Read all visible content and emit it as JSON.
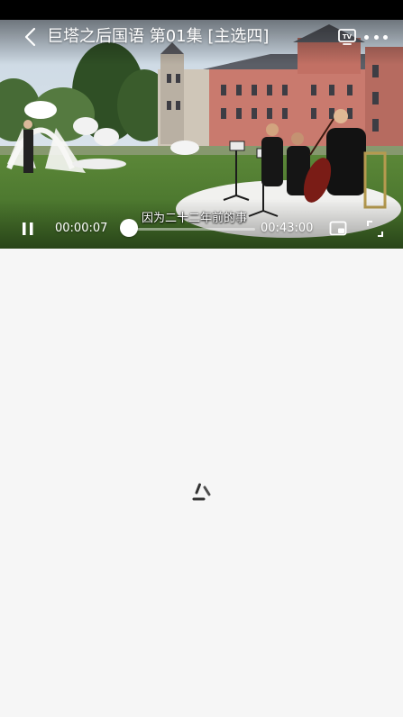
{
  "player": {
    "title": "巨塔之后国语 第01集 [主选四]",
    "subtitle": "因为二十二年前的事",
    "current_time": "00:00:07",
    "total_time": "00:43:00",
    "progress_fraction": 0.0027,
    "tv_badge": "TV"
  },
  "icons": {
    "back": "chevron-left-icon",
    "tv": "tv-cast-icon",
    "more": "more-dots-icon",
    "pause": "pause-icon",
    "pip": "picture-in-picture-icon",
    "fullscreen": "fullscreen-icon",
    "loading": "loading-spinner-icon"
  },
  "colors": {
    "background": "#f6f6f6",
    "overlay_text": "#ffffff",
    "spinner": "#333333"
  }
}
